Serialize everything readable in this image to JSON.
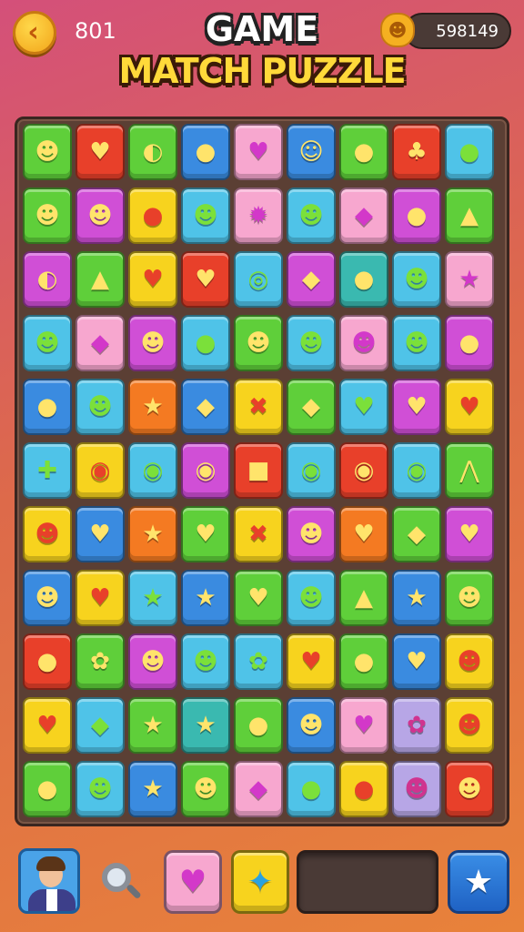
{
  "header": {
    "back_icon": "‹",
    "moves": "801",
    "title_line1": "GAME",
    "title_line2": "MATCH PUZZLE",
    "coin_icon": "☻",
    "score": "598149"
  },
  "board": {
    "rows": [
      [
        [
          "green",
          "☻"
        ],
        [
          "red",
          "♥"
        ],
        [
          "green",
          "◐"
        ],
        [
          "blue",
          "●"
        ],
        [
          "pink",
          "♥"
        ],
        [
          "blue",
          "☺"
        ],
        [
          "green",
          "●"
        ],
        [
          "red",
          "♣"
        ],
        [
          "cyan",
          "●"
        ]
      ],
      [
        [
          "green",
          "☻"
        ],
        [
          "magenta",
          "☻"
        ],
        [
          "yellow",
          "●"
        ],
        [
          "cyan",
          "☻"
        ],
        [
          "pink",
          "✹"
        ],
        [
          "cyan",
          "☻"
        ],
        [
          "pink",
          "◆"
        ],
        [
          "magenta",
          "●"
        ],
        [
          "green",
          "▲"
        ]
      ],
      [
        [
          "magenta",
          "◐"
        ],
        [
          "green",
          "▲"
        ],
        [
          "yellow",
          "♥"
        ],
        [
          "red",
          "♥"
        ],
        [
          "cyan",
          "◎"
        ],
        [
          "magenta",
          "◆"
        ],
        [
          "teal",
          "●"
        ],
        [
          "cyan",
          "☻"
        ],
        [
          "pink",
          "★"
        ]
      ],
      [
        [
          "cyan",
          "☻"
        ],
        [
          "pink",
          "◆"
        ],
        [
          "magenta",
          "☻"
        ],
        [
          "cyan",
          "●"
        ],
        [
          "green",
          "☻"
        ],
        [
          "cyan",
          "☻"
        ],
        [
          "pink",
          "☻"
        ],
        [
          "cyan",
          "☻"
        ],
        [
          "magenta",
          "●"
        ]
      ],
      [
        [
          "blue",
          "●"
        ],
        [
          "cyan",
          "☻"
        ],
        [
          "orange",
          "★"
        ],
        [
          "blue",
          "◆"
        ],
        [
          "yellow",
          "✖"
        ],
        [
          "green",
          "◆"
        ],
        [
          "cyan",
          "♥"
        ],
        [
          "magenta",
          "♥"
        ],
        [
          "yellow",
          "♥"
        ]
      ],
      [
        [
          "cyan",
          "✚"
        ],
        [
          "yellow",
          "◉"
        ],
        [
          "cyan",
          "◉"
        ],
        [
          "magenta",
          "◉"
        ],
        [
          "red",
          "■"
        ],
        [
          "cyan",
          "◉"
        ],
        [
          "red",
          "◉"
        ],
        [
          "cyan",
          "◉"
        ],
        [
          "green",
          "⋀"
        ]
      ],
      [
        [
          "yellow",
          "☻"
        ],
        [
          "blue",
          "♥"
        ],
        [
          "orange",
          "★"
        ],
        [
          "green",
          "♥"
        ],
        [
          "yellow",
          "✖"
        ],
        [
          "magenta",
          "☻"
        ],
        [
          "orange",
          "♥"
        ],
        [
          "green",
          "◆"
        ],
        [
          "magenta",
          "♥"
        ]
      ],
      [
        [
          "blue",
          "☻"
        ],
        [
          "yellow",
          "♥"
        ],
        [
          "cyan",
          "★"
        ],
        [
          "blue",
          "★"
        ],
        [
          "green",
          "♥"
        ],
        [
          "cyan",
          "☻"
        ],
        [
          "green",
          "▲"
        ],
        [
          "blue",
          "★"
        ],
        [
          "green",
          "☻"
        ]
      ],
      [
        [
          "red",
          "●"
        ],
        [
          "green",
          "✿"
        ],
        [
          "magenta",
          "☻"
        ],
        [
          "cyan",
          "☻"
        ],
        [
          "cyan",
          "✿"
        ],
        [
          "yellow",
          "♥"
        ],
        [
          "green",
          "●"
        ],
        [
          "blue",
          "♥"
        ],
        [
          "yellow",
          "☻"
        ]
      ],
      [
        [
          "yellow",
          "♥"
        ],
        [
          "cyan",
          "◆"
        ],
        [
          "green",
          "★"
        ],
        [
          "teal",
          "★"
        ],
        [
          "green",
          "●"
        ],
        [
          "blue",
          "☻"
        ],
        [
          "pink",
          "♥"
        ],
        [
          "lavender",
          "✿"
        ],
        [
          "yellow",
          "☻"
        ]
      ],
      [
        [
          "green",
          "●"
        ],
        [
          "cyan",
          "☻"
        ],
        [
          "blue",
          "★"
        ],
        [
          "green",
          "☻"
        ],
        [
          "pink",
          "◆"
        ],
        [
          "cyan",
          "●"
        ],
        [
          "yellow",
          "●"
        ],
        [
          "lavender",
          "☻"
        ],
        [
          "red",
          "☻"
        ]
      ]
    ]
  },
  "colors": {
    "green": "#5fcf3a",
    "red": "#e8402a",
    "blue": "#3a8be0",
    "pink": "#f7a7cf",
    "cyan": "#4fc3e8",
    "magenta": "#d04fd6",
    "yellow": "#f7d31e",
    "orange": "#f47a22",
    "teal": "#3ab9b0",
    "lavender": "#b7a6e6"
  },
  "bottom": {
    "tray": [
      {
        "color": "#f7a7cf",
        "icon": "♥",
        "icon_color": "#d338c9"
      },
      {
        "color": "#f7d31e",
        "icon": "✦",
        "icon_color": "#2aa2e0"
      }
    ],
    "action_icon": "★"
  }
}
